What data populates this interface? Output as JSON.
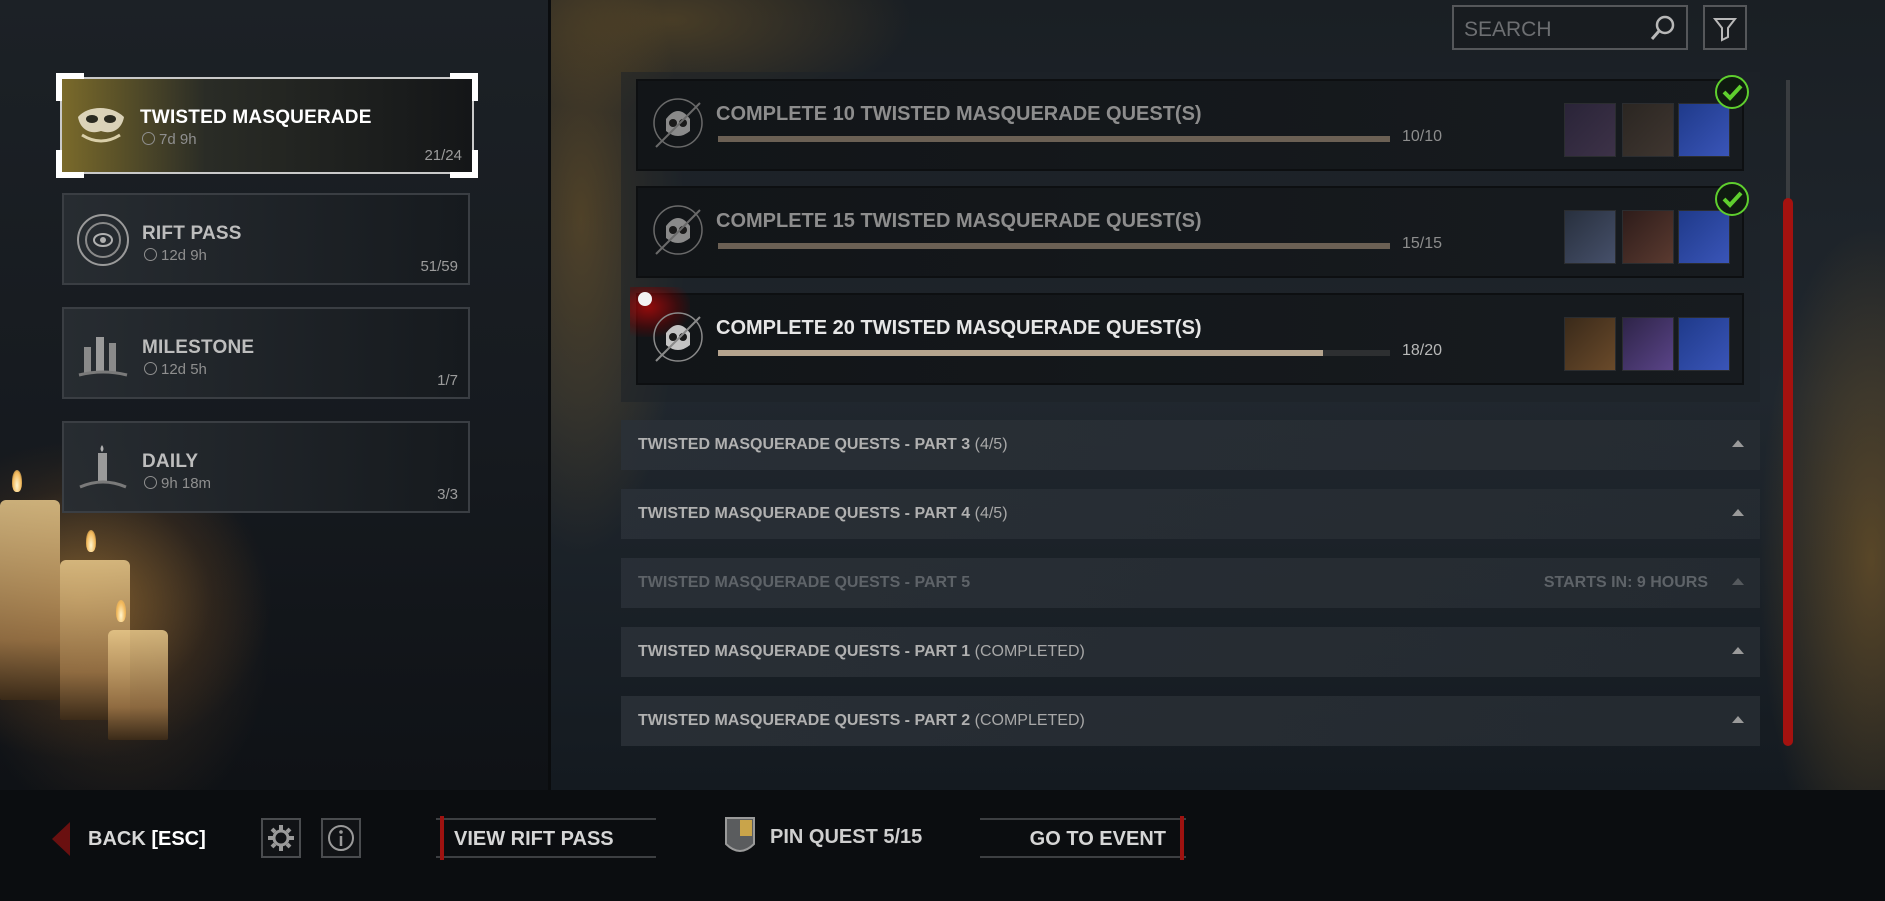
{
  "tabs": [
    {
      "title": "TWISTED MASQUERADE",
      "time": "7d 9h",
      "count": "21/24"
    },
    {
      "title": "RIFT PASS",
      "time": "12d 9h",
      "count": "51/59"
    },
    {
      "title": "MILESTONE",
      "time": "12d 5h",
      "count": "1/7"
    },
    {
      "title": "DAILY",
      "time": "9h 18m",
      "count": "3/3"
    }
  ],
  "search": {
    "placeholder": "SEARCH"
  },
  "quests": [
    {
      "title": "COMPLETE 10 TWISTED MASQUERADE QUEST(S)",
      "progress": "10/10",
      "fraction": 1.0,
      "completed": true
    },
    {
      "title": "COMPLETE 15 TWISTED MASQUERADE QUEST(S)",
      "progress": "15/15",
      "fraction": 1.0,
      "completed": true
    },
    {
      "title": "COMPLETE 20 TWISTED MASQUERADE QUEST(S)",
      "progress": "18/20",
      "fraction": 0.9,
      "completed": false
    }
  ],
  "sections": [
    {
      "title": "TWISTED MASQUERADE QUESTS - PART 3",
      "status": "(4/5)",
      "right": ""
    },
    {
      "title": "TWISTED MASQUERADE QUESTS - PART 4",
      "status": "(4/5)",
      "right": ""
    },
    {
      "title": "TWISTED MASQUERADE QUESTS - PART 5",
      "status": "",
      "right": "STARTS IN: 9 HOURS"
    },
    {
      "title": "TWISTED MASQUERADE QUESTS - PART 1",
      "status": "(COMPLETED)",
      "right": ""
    },
    {
      "title": "TWISTED MASQUERADE QUESTS - PART 2",
      "status": "(COMPLETED)",
      "right": ""
    }
  ],
  "bottom": {
    "back_label": "BACK",
    "back_key": "[ESC]",
    "view_rift_pass": "VIEW RIFT PASS",
    "pin_quest": "PIN QUEST 5/15",
    "go_to_event": "GO TO EVENT"
  },
  "colors": {
    "accent_red": "#a4120f",
    "check_green": "#5fcf2e",
    "reward_blue": "#1f3a8a"
  }
}
